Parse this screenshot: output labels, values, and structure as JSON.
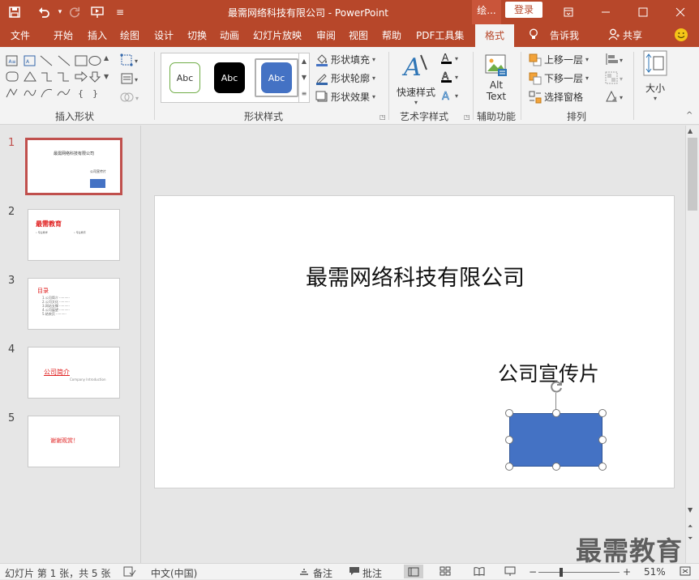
{
  "titlebar": {
    "title": "最需网络科技有限公司  -  PowerPoint",
    "context_tab": "绘...",
    "login": "登录"
  },
  "tabs": [
    "文件",
    "开始",
    "插入",
    "绘图",
    "设计",
    "切换",
    "动画",
    "幻灯片放映",
    "审阅",
    "视图",
    "帮助",
    "PDF工具集",
    "格式",
    "告诉我",
    "共享"
  ],
  "active_tab": "格式",
  "ribbon": {
    "groups": {
      "insert_shapes": "插入形状",
      "shape_styles": "形状样式",
      "wordart_styles": "艺术字样式",
      "accessibility": "辅助功能",
      "arrange": "排列"
    },
    "gallery": [
      "Abc",
      "Abc",
      "Abc"
    ],
    "shape_fill": "形状填充",
    "shape_outline": "形状轮廓",
    "shape_effects": "形状效果",
    "quick_styles": "快速样式",
    "alt_text_1": "Alt",
    "alt_text_2": "Text",
    "bring_forward": "上移一层",
    "send_backward": "下移一层",
    "selection_pane": "选择窗格",
    "size": "大小",
    "colors": {
      "accent": "#b7472a",
      "shape_blue": "#4472c4"
    }
  },
  "thumbnails": [
    {
      "num": "1",
      "line1": "最需网络科技有限公司",
      "line2": "公司宣传片"
    },
    {
      "num": "2",
      "title": "最需教育",
      "item1": "• 专业教学",
      "item2": "• 专业教育"
    },
    {
      "num": "3",
      "title": "目录",
      "items": [
        "1.公司简介 ··········",
        "2.公司文化 ··········",
        "3.网站支撑 ··········",
        "4.公司展望 ··········",
        "5.结束页 ··········"
      ]
    },
    {
      "num": "4",
      "title": "公司简介",
      "subtitle": "Company  Introduction"
    },
    {
      "num": "5",
      "title": "谢谢观赏！"
    }
  ],
  "slide": {
    "title": "最需网络科技有限公司",
    "subtitle": "公司宣传片"
  },
  "status": {
    "slide_info": "幻灯片 第 1 张，共 5 张",
    "language": "中文(中国)",
    "notes": "备注",
    "comments": "批注",
    "zoom": "51%"
  },
  "watermark": "最需教育"
}
